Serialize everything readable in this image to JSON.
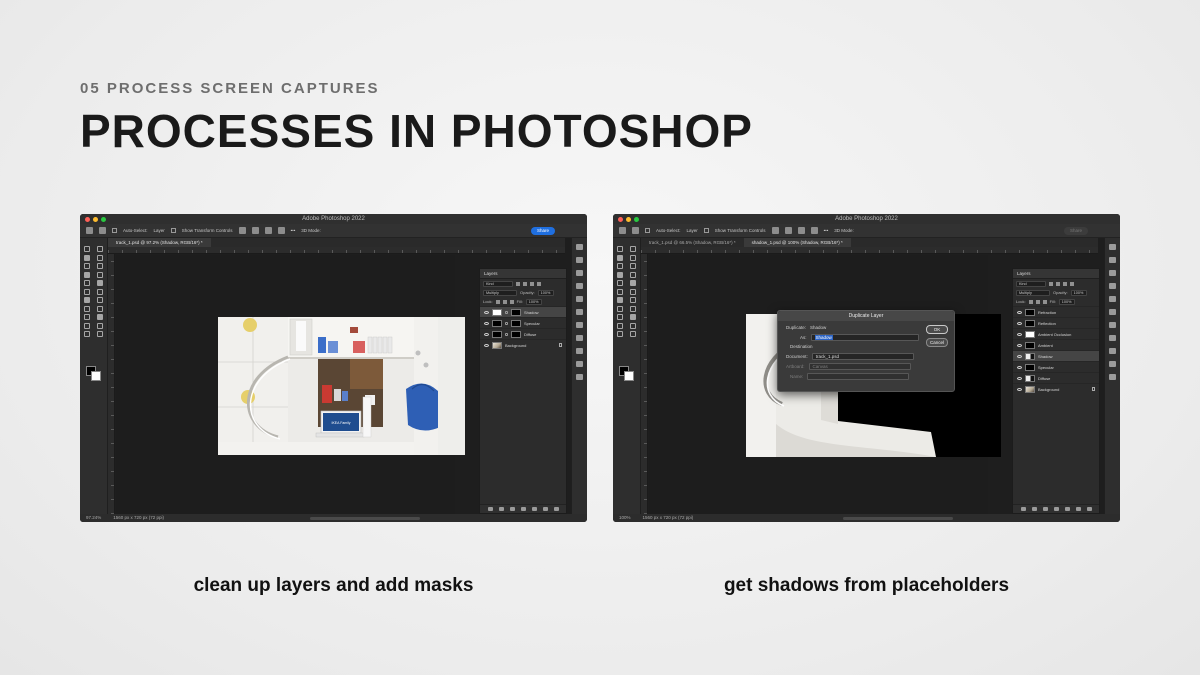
{
  "header": {
    "eyebrow": "05 PROCESS SCREEN CAPTURES",
    "title": "PROCESSES IN PHOTOSHOP"
  },
  "captions": {
    "left": "clean up layers and add masks",
    "right": "get shadows from placeholders"
  },
  "app": {
    "window_title": "Adobe Photoshop 2022",
    "options": {
      "auto_select": "Auto-Select:",
      "target": "Layer",
      "transform_controls": "Show Transform Controls",
      "mode_3d": "3D Mode:",
      "share": "Share"
    }
  },
  "screen1": {
    "tabs": [
      "track_1.psd @ 97.2% (Shadow, RGB/16*) *"
    ],
    "status_zoom": "97.24%",
    "status_info": "1560 px x 720 px (72 ppi)",
    "layers_panel": {
      "title": "Layers",
      "filter": "Kind",
      "blend_mode": "Multiply",
      "opacity_label": "Opacity:",
      "opacity": "100%",
      "lock_label": "Lock:",
      "fill_label": "Fill:",
      "fill": "100%",
      "layers": [
        {
          "name": "Shadow",
          "selected": true
        },
        {
          "name": "Specular",
          "selected": false
        },
        {
          "name": "Diffuse",
          "selected": false
        },
        {
          "name": "Background",
          "selected": false
        }
      ]
    },
    "photo_sign": "IKEA Family"
  },
  "screen2": {
    "tabs": [
      "track_1.psd @ 66.5% (Shadow, RGB/16*) *",
      "shadow_1.psd @ 100% (Shadow, RGB/16*) *"
    ],
    "status_zoom": "100%",
    "status_info": "1560 px x 720 px (72 ppi)",
    "layers_panel": {
      "title": "Layers",
      "filter": "Kind",
      "blend_mode": "Multiply",
      "opacity_label": "Opacity:",
      "opacity": "100%",
      "lock_label": "Lock:",
      "fill_label": "Fill:",
      "fill": "100%",
      "layers": [
        {
          "name": "Refraction",
          "selected": false
        },
        {
          "name": "Reflection",
          "selected": false
        },
        {
          "name": "Ambient Occlusion",
          "selected": false
        },
        {
          "name": "Ambient",
          "selected": false
        },
        {
          "name": "Shadow",
          "selected": true
        },
        {
          "name": "Specular",
          "selected": false
        },
        {
          "name": "Diffuse",
          "selected": false
        },
        {
          "name": "Background",
          "selected": false
        }
      ]
    },
    "dialog": {
      "title": "Duplicate Layer",
      "duplicate_label": "Duplicate:",
      "duplicate_value": "Shadow",
      "as_label": "As:",
      "as_value": "Shadow",
      "destination_label": "Destination",
      "document_label": "Document:",
      "document_value": "track_1.psd",
      "artboard_label": "Artboard:",
      "artboard_value": "Canvas",
      "name_label": "Name:",
      "ok": "OK",
      "cancel": "Cancel"
    }
  }
}
